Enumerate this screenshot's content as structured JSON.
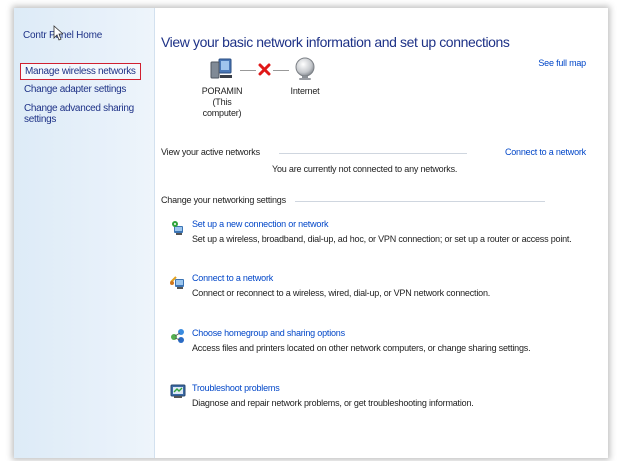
{
  "sidebar": {
    "home_label": "Contr  Panel Home",
    "items": [
      {
        "label": "Manage wireless networks"
      },
      {
        "label": "Change adapter settings"
      },
      {
        "label": "Change advanced sharing settings"
      }
    ]
  },
  "main": {
    "title": "View your basic network information and set up connections",
    "see_full_map": "See full map",
    "network_map": {
      "computer_name": "PORAMIN",
      "computer_note": "(This computer)",
      "internet_label": "Internet"
    },
    "active_networks": {
      "label": "View your active networks",
      "status": "You are currently not connected to any networks.",
      "connect_link": "Connect to a network"
    },
    "change_settings": {
      "label": "Change your networking settings",
      "tasks": [
        {
          "title": "Set up a new connection or network",
          "desc": "Set up a wireless, broadband, dial-up, ad hoc, or VPN connection; or set up a router or access point.",
          "icon": "network-setup-icon"
        },
        {
          "title": "Connect to a network",
          "desc": "Connect or reconnect to a wireless, wired, dial-up, or VPN network connection.",
          "icon": "connect-network-icon"
        },
        {
          "title": "Choose homegroup and sharing options",
          "desc": "Access files and printers located on other network computers, or change sharing settings.",
          "icon": "homegroup-icon"
        },
        {
          "title": "Troubleshoot problems",
          "desc": "Diagnose and repair network problems, or get troubleshooting information.",
          "icon": "troubleshoot-icon"
        }
      ]
    }
  }
}
